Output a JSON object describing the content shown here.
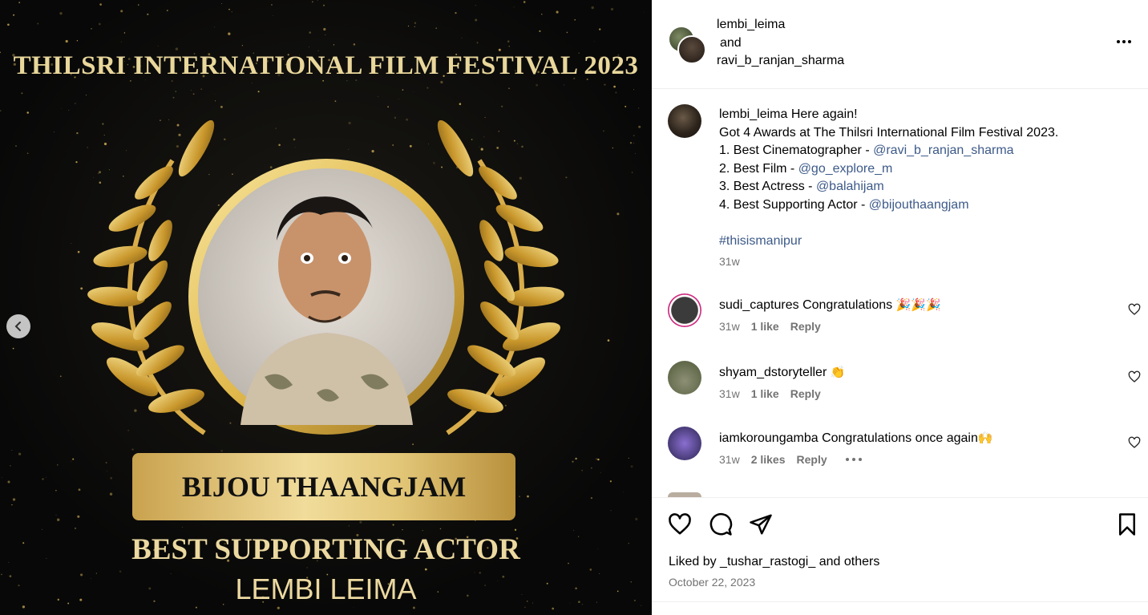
{
  "poster": {
    "title": "THILSRI INTERNATIONAL FILM FESTIVAL 2023",
    "name": "BIJOU THAANGJAM",
    "award": "BEST SUPPORTING ACTOR",
    "film": "LEMBI LEIMA"
  },
  "header": {
    "user1": "lembi_leima",
    "and": "and",
    "user2": "ravi_b_ranjan_sharma"
  },
  "caption": {
    "user": "lembi_leima",
    "line1": "Here again!",
    "line2": "Got 4 Awards at The Thilsri International Film Festival 2023.",
    "items": [
      {
        "text": "1. Best Cinematographer - ",
        "mention": "@ravi_b_ranjan_sharma"
      },
      {
        "text": "2. Best Film - ",
        "mention": "@go_explore_m"
      },
      {
        "text": "3. Best Actress - ",
        "mention": "@balahijam"
      },
      {
        "text": "4. Best Supporting Actor - ",
        "mention": "@bijouthaangjam"
      }
    ],
    "hashtag": "#thisismanipur",
    "time": "31w"
  },
  "comments": [
    {
      "user": "sudi_captures",
      "text": "Congratulations",
      "emoji": "🎉🎉🎉",
      "time": "31w",
      "likes": "1 like",
      "reply": "Reply"
    },
    {
      "user": "shyam_dstoryteller",
      "text": "",
      "emoji": "👏",
      "time": "31w",
      "likes": "1 like",
      "reply": "Reply"
    },
    {
      "user": "iamkoroungamba",
      "text": "Congratulations once again",
      "emoji": "🙌",
      "time": "31w",
      "likes": "2 likes",
      "reply": "Reply"
    }
  ],
  "footer": {
    "liked_prefix": "Liked by",
    "liked_user": "_tushar_rastogi_",
    "liked_and": "and",
    "liked_others": "others",
    "date": "October 22, 2023"
  },
  "colors": {
    "link": "#3d5a89",
    "muted": "#737373",
    "gold": "#e9d79b",
    "media_bg": "#0b0b0b"
  }
}
